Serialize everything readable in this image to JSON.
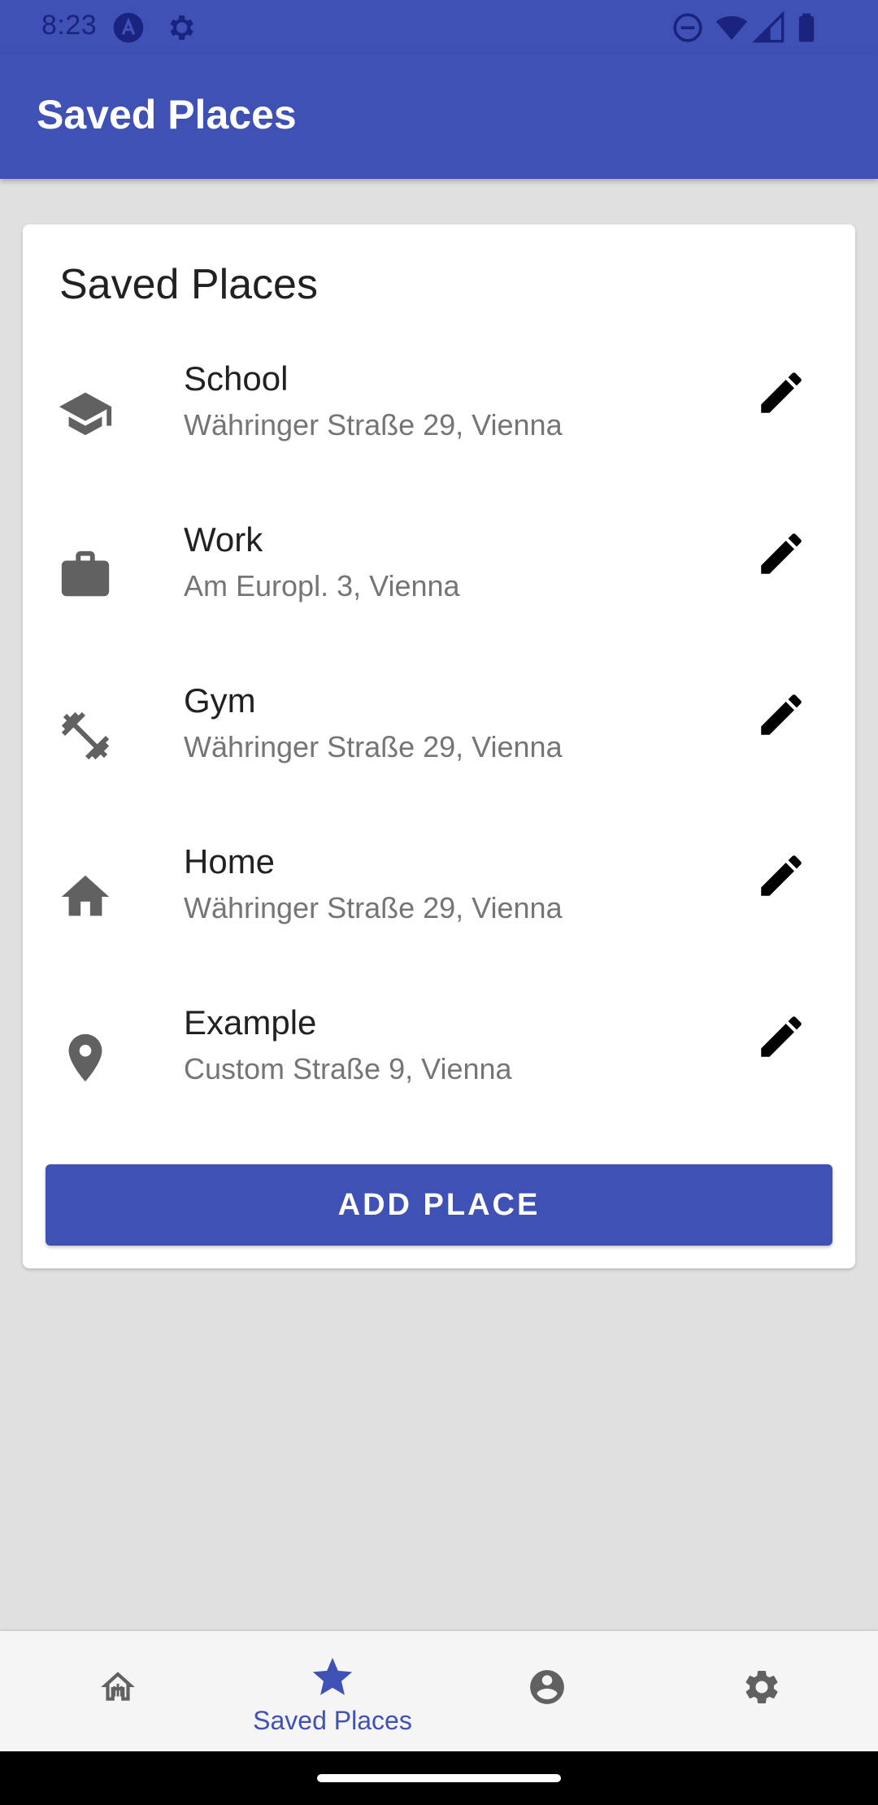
{
  "status_bar": {
    "time": "8:23",
    "icons": [
      "app-notification-icon",
      "settings-notification-icon",
      "do-not-disturb-icon",
      "wifi-icon",
      "cell-signal-icon",
      "battery-icon"
    ]
  },
  "app_bar": {
    "title": "Saved Places",
    "color": "#3f51b5"
  },
  "card": {
    "title": "Saved Places",
    "places": [
      {
        "name": "School",
        "address": "Währinger Straße 29, Vienna",
        "icon": "school-icon"
      },
      {
        "name": "Work",
        "address": "Am Europl. 3, Vienna",
        "icon": "work-icon"
      },
      {
        "name": "Gym",
        "address": "Währinger Straße 29, Vienna",
        "icon": "fitness-icon"
      },
      {
        "name": "Home",
        "address": "Währinger Straße 29, Vienna",
        "icon": "home-icon"
      },
      {
        "name": "Example",
        "address": "Custom Straße 9, Vienna",
        "icon": "location-pin-icon"
      }
    ],
    "add_button_label": "ADD PLACE"
  },
  "bottom_nav": {
    "items": [
      {
        "icon": "home-icon",
        "label": ""
      },
      {
        "icon": "star-icon",
        "label": "Saved Places",
        "active": true
      },
      {
        "icon": "account-circle-icon",
        "label": ""
      },
      {
        "icon": "gear-icon",
        "label": ""
      }
    ],
    "active_color": "#3f51b5"
  }
}
